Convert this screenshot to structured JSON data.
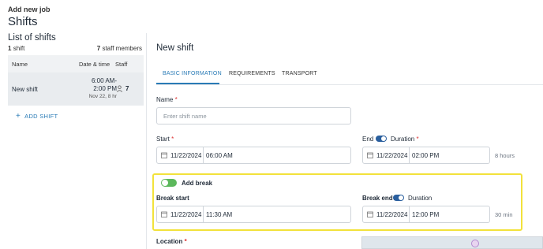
{
  "header": {
    "subtitle": "Add new job",
    "title": "Shifts"
  },
  "left": {
    "heading": "List of shifts",
    "shift_count": "1",
    "shift_label": "shift",
    "staff_count": "7",
    "staff_label": "staff members",
    "columns": {
      "name": "Name",
      "datetime": "Date & time",
      "staff": "Staff"
    },
    "row": {
      "name": "New shift",
      "time_line1": "6:00 AM-",
      "time_line2": "2:00 PM",
      "time_line3": "Nov 22, 8 hr",
      "staff": "7"
    },
    "add_shift": "ADD SHIFT"
  },
  "main": {
    "title": "New shift",
    "tabs": [
      {
        "label": "BASIC INFORMATION",
        "active": true
      },
      {
        "label": "REQUIREMENTS",
        "active": false
      },
      {
        "label": "TRANSPORT",
        "active": false
      }
    ],
    "name": {
      "label": "Name",
      "required": "*",
      "placeholder": "Enter shift name"
    },
    "start": {
      "label": "Start",
      "required": "*",
      "date": "11/22/2024",
      "time": "06:00 AM"
    },
    "end": {
      "label": "End",
      "duration_label": "Duration",
      "required": "*",
      "date": "11/22/2024",
      "time": "02:00 PM",
      "hours": "8 hours"
    },
    "break": {
      "toggle_label": "Add break",
      "start_label": "Break start",
      "start_date": "11/22/2024",
      "start_time": "11:30 AM",
      "end_label": "Break end",
      "duration_label": "Duration",
      "end_date": "11/22/2024",
      "end_time": "12:00 PM",
      "minutes": "30 min"
    },
    "location": {
      "label": "Location",
      "required": "*"
    }
  },
  "colors": {
    "accent": "#2a7bb6",
    "highlight": "#f2e23b",
    "toggle_green": "#5cb85c"
  }
}
